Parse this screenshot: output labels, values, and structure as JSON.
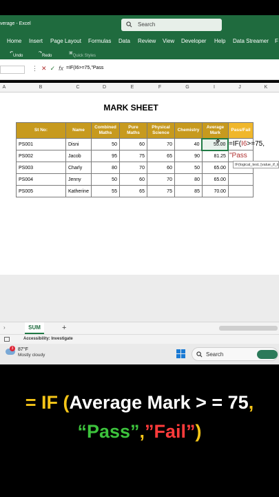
{
  "window": {
    "doc_title": "verage  -  Excel",
    "search_placeholder": "Search"
  },
  "ribbon_tabs": [
    "Home",
    "Insert",
    "Page Layout",
    "Formulas",
    "Data",
    "Review",
    "View",
    "Developer",
    "Help",
    "Data Streamer",
    "F"
  ],
  "quick_access": {
    "undo": "Undo",
    "redo": "Redo",
    "styles": "Quick Styles"
  },
  "formula_bar": {
    "fx": "fx",
    "formula": "=IF(I6>=75,\"Pass"
  },
  "columns": [
    "A",
    "B",
    "C",
    "D",
    "E",
    "F",
    "G",
    "I",
    "J",
    "K"
  ],
  "sheet": {
    "title": "MARK SHEET",
    "headers": [
      "St No:",
      "Name",
      "Combined Maths",
      "Pure Maths",
      "Physical Science",
      "Chemistry",
      "Average Mark",
      "Pass/Fail"
    ],
    "rows": [
      {
        "st_no": "PS001",
        "name": "Disni",
        "combined": "50",
        "pure": "60",
        "physical": "70",
        "chemistry": "40",
        "average": "55.00",
        "pass_fail": ""
      },
      {
        "st_no": "PS002",
        "name": "Jacob",
        "combined": "95",
        "pure": "75",
        "physical": "65",
        "chemistry": "90",
        "average": "81.25",
        "pass_fail": ""
      },
      {
        "st_no": "PS003",
        "name": "Charly",
        "combined": "80",
        "pure": "70",
        "physical": "60",
        "chemistry": "50",
        "average": "65.00",
        "pass_fail": ""
      },
      {
        "st_no": "PS004",
        "name": "Jenny",
        "combined": "50",
        "pure": "60",
        "physical": "70",
        "chemistry": "80",
        "average": "65.00",
        "pass_fail": ""
      },
      {
        "st_no": "PS005",
        "name": "Katherine",
        "combined": "55",
        "pure": "65",
        "physical": "75",
        "chemistry": "85",
        "average": "70.00",
        "pass_fail": ""
      }
    ],
    "cell_edit_line1_prefix": "=IF(",
    "cell_edit_ref": "I6",
    "cell_edit_line1_suffix": ">=75,",
    "cell_edit_line2": "\"Pass",
    "tooltip": "IF(logical_test, [value_if_true]"
  },
  "sheet_tabs": {
    "active": "SUM",
    "add": "+"
  },
  "status": {
    "accessibility": "Accessibility: Investigate"
  },
  "taskbar": {
    "badge": "3",
    "temp": "87°F",
    "weather": "Mostly cloudy",
    "search": "Search"
  },
  "caption": {
    "eq": "= IF (",
    "body": "Average Mark > = 75",
    "comma": ",",
    "pass": "“Pass”",
    "sep": ",",
    "fail": "”Fail”",
    "close": ")"
  }
}
